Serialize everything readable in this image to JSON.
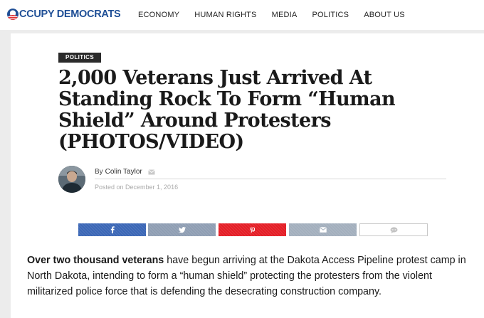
{
  "site": {
    "logo_text": "CCUPY DEMOCRATS",
    "brand_color": "#1f4f96"
  },
  "nav": {
    "items": [
      "ECONOMY",
      "HUMAN RIGHTS",
      "MEDIA",
      "POLITICS",
      "ABOUT US"
    ]
  },
  "article": {
    "category": "POLITICS",
    "title": "2,000 Veterans Just Arrived At Standing Rock To Form “Human Shield” Around Protesters (PHOTOS/VIDEO)",
    "by_prefix": "By",
    "author": "Colin Taylor",
    "posted": "Posted on December 1, 2016",
    "lead_bold": "Over two thousand veterans",
    "lead_rest": " have begun arriving at the Dakota Access Pipeline protest camp in North Dakota, intending to form a “human shield” protecting the protesters from the violent militarized police force that is defending the desecrating construction company."
  },
  "share": {
    "buttons": [
      {
        "name": "facebook",
        "icon": "facebook-icon",
        "color": "#3b67b6"
      },
      {
        "name": "twitter",
        "icon": "twitter-icon",
        "color": "#8f9eb3"
      },
      {
        "name": "pinterest",
        "icon": "pinterest-icon",
        "color": "#e41e26"
      },
      {
        "name": "email",
        "icon": "envelope-icon",
        "color": "#a3afbd"
      },
      {
        "name": "comment",
        "icon": "comment-icon",
        "color": "#ffffff"
      }
    ]
  }
}
